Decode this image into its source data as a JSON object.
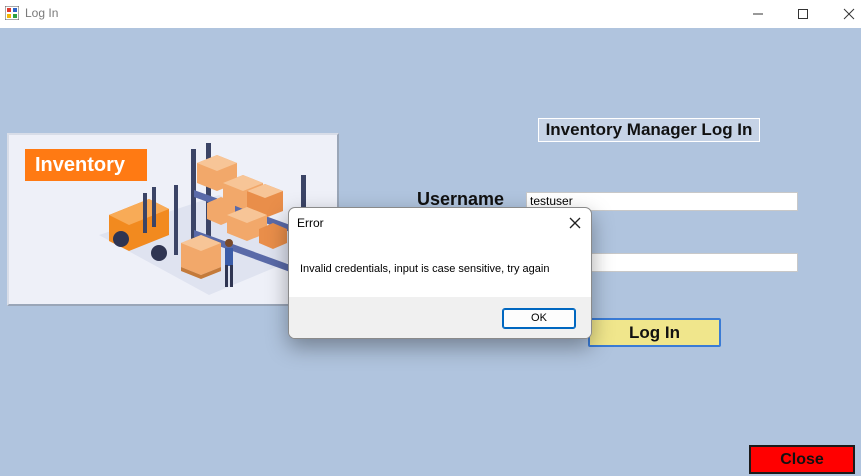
{
  "window": {
    "title": "Log In"
  },
  "logo": {
    "label": "Inventory"
  },
  "form": {
    "title": "Inventory Manager Log In",
    "username_label": "Username",
    "username_value": "testuser",
    "password_value": "",
    "login_label": "Log In",
    "close_label": "Close"
  },
  "dialog": {
    "title": "Error",
    "message": "Invalid credentials, input is case sensitive, try again",
    "ok_label": "OK"
  },
  "colors": {
    "background": "#b0c4de",
    "login_button": "#f0e68c",
    "close_button": "#ff0000",
    "logo_tag": "#ff7a13"
  },
  "icons": [
    "app-icon",
    "minimize-icon",
    "maximize-icon",
    "close-icon",
    "dialog-close-icon"
  ]
}
